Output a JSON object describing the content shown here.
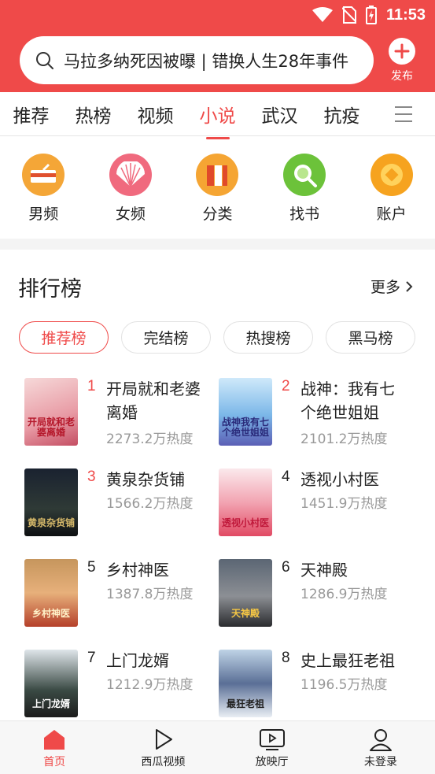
{
  "status_bar": {
    "time": "11:53"
  },
  "search": {
    "text": "马拉多纳死因被曝 | 错换人生28年事件"
  },
  "publish": {
    "label": "发布"
  },
  "tabs": [
    {
      "label": "推荐"
    },
    {
      "label": "热榜"
    },
    {
      "label": "视频"
    },
    {
      "label": "小说",
      "active": true
    },
    {
      "label": "武汉"
    },
    {
      "label": "抗疫"
    }
  ],
  "shortcuts": [
    {
      "label": "男频",
      "icon": "male-novel-icon"
    },
    {
      "label": "女频",
      "icon": "female-novel-icon"
    },
    {
      "label": "分类",
      "icon": "category-icon"
    },
    {
      "label": "找书",
      "icon": "find-book-icon"
    },
    {
      "label": "账户",
      "icon": "account-icon"
    }
  ],
  "ranking": {
    "title": "排行榜",
    "more": "更多",
    "chips": [
      {
        "label": "推荐榜",
        "active": true
      },
      {
        "label": "完结榜"
      },
      {
        "label": "热搜榜"
      },
      {
        "label": "黑马榜"
      }
    ],
    "books": [
      {
        "rank": "1",
        "title": "开局就和老婆离婚",
        "heat": "2273.2万热度",
        "cover_text": "开局就和老婆离婚"
      },
      {
        "rank": "2",
        "title": "战神：我有七个绝世姐姐",
        "heat": "2101.2万热度",
        "cover_text": "战神我有七个绝世姐姐"
      },
      {
        "rank": "3",
        "title": "黄泉杂货铺",
        "heat": "1566.2万热度",
        "cover_text": "黄泉杂货铺"
      },
      {
        "rank": "4",
        "title": "透视小村医",
        "heat": "1451.9万热度",
        "cover_text": "透视小村医"
      },
      {
        "rank": "5",
        "title": "乡村神医",
        "heat": "1387.8万热度",
        "cover_text": "乡村神医"
      },
      {
        "rank": "6",
        "title": "天神殿",
        "heat": "1286.9万热度",
        "cover_text": "天神殿"
      },
      {
        "rank": "7",
        "title": "上门龙婿",
        "heat": "1212.9万热度",
        "cover_text": "上门龙婿"
      },
      {
        "rank": "8",
        "title": "史上最狂老祖",
        "heat": "1196.5万热度",
        "cover_text": "最狂老祖"
      }
    ]
  },
  "bottom_nav": [
    {
      "label": "首页",
      "active": true
    },
    {
      "label": "西瓜视频"
    },
    {
      "label": "放映厅"
    },
    {
      "label": "未登录"
    }
  ],
  "colors": {
    "accent": "#ef4a49"
  }
}
